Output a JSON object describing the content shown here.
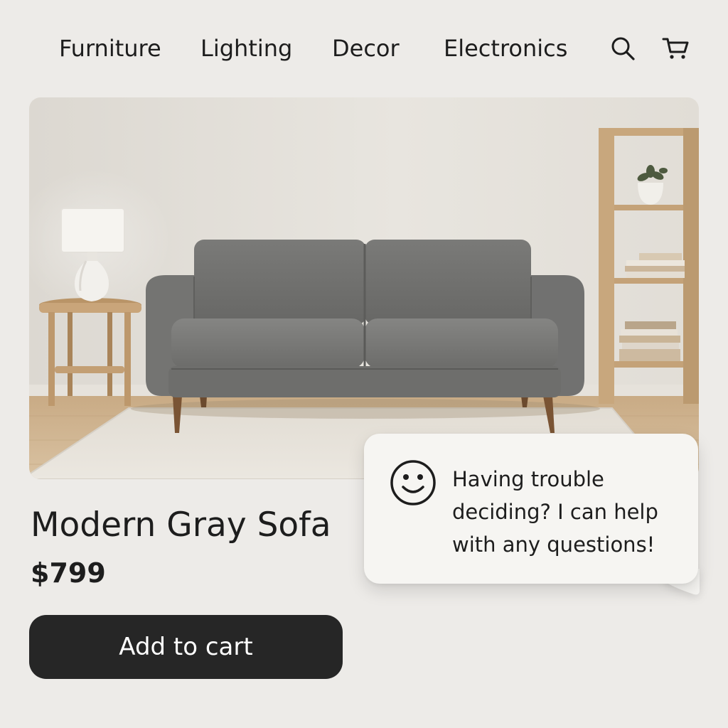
{
  "nav": {
    "items": [
      {
        "label": "Furniture"
      },
      {
        "label": "Lighting"
      },
      {
        "label": "Decor"
      },
      {
        "label": "Electronics"
      }
    ],
    "search_icon": "search-icon",
    "cart_icon": "cart-icon"
  },
  "hero": {
    "image": "modern-gray-sofa-room-photo"
  },
  "product": {
    "title": "Modern Gray Sofa",
    "price": "$799",
    "add_to_cart_label": "Add to cart"
  },
  "assistant": {
    "icon": "smiley-icon",
    "message_lines": [
      "Having trouble",
      "deciding? I can help",
      "with any questions!"
    ]
  },
  "colors": {
    "page_background": "#edebe8",
    "button_background": "#262626",
    "button_text": "#ffffff",
    "bubble_background": "#f6f5f2",
    "text": "#1d1d1d"
  }
}
